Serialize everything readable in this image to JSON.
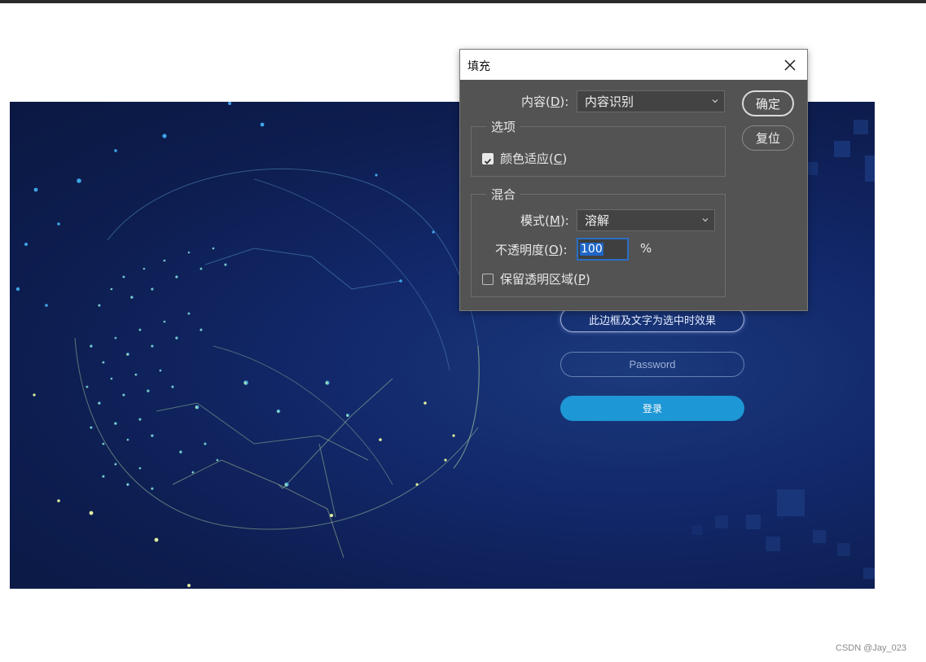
{
  "login_page": {
    "username_field_text": "此边框及文字为选中时效果",
    "password_placeholder": "Password",
    "login_button_label": "登录"
  },
  "fill_dialog": {
    "title": "填充",
    "content": {
      "label": "内容(",
      "mnemonic": "D",
      "label_end": "):",
      "value": "内容识别"
    },
    "options_group": {
      "title": "选项",
      "color_adapt": {
        "label": "颜色适应(",
        "mnemonic": "C",
        "label_end": ")",
        "checked": true
      }
    },
    "blend_group": {
      "title": "混合",
      "mode": {
        "label": "模式(",
        "mnemonic": "M",
        "label_end": "):",
        "value": "溶解"
      },
      "opacity": {
        "label": "不透明度(",
        "mnemonic": "O",
        "label_end": "):",
        "value": "100",
        "unit": "%"
      },
      "preserve_transparency": {
        "label": "保留透明区域(",
        "mnemonic": "P",
        "label_end": ")",
        "checked": false
      }
    },
    "ok_button": "确定",
    "reset_button": "复位"
  },
  "watermark": "CSDN @Jay_023",
  "colors": {
    "dialog_bg": "#535353",
    "login_button": "#1d97d5",
    "background_navy": "#0d1d4f",
    "selection_blue": "#1f66c7"
  }
}
